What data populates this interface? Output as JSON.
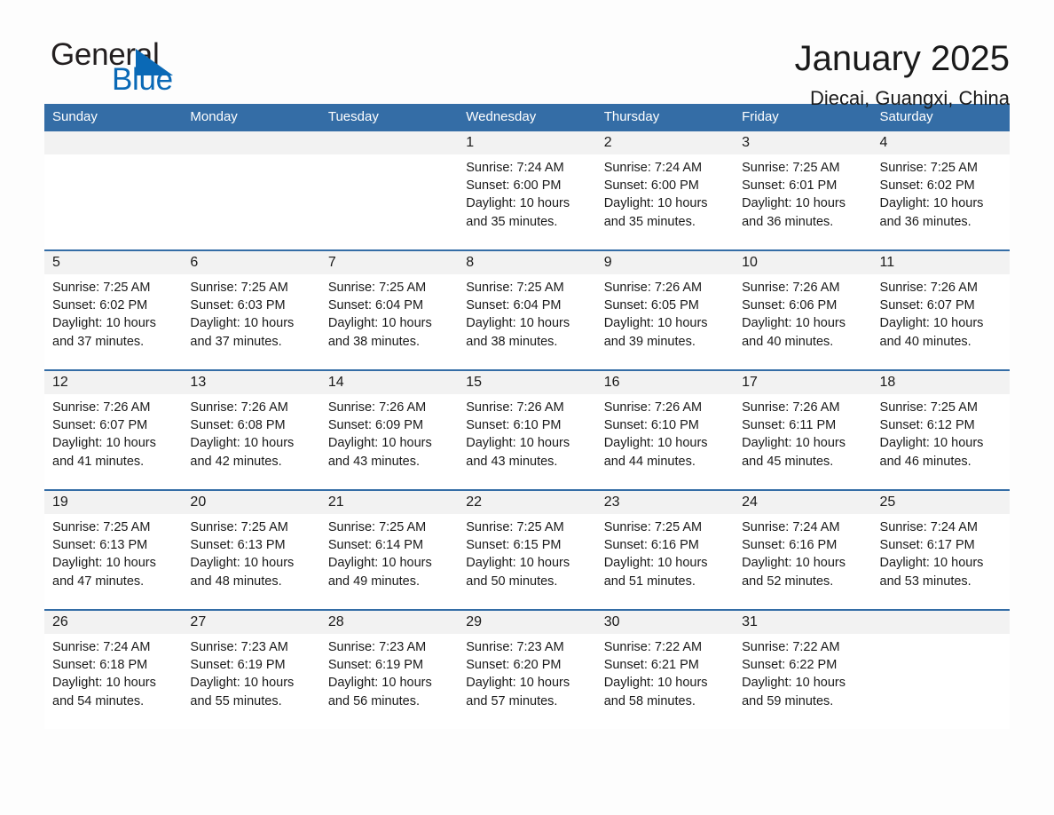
{
  "brand": {
    "name_part1": "General",
    "name_part2": "Blue",
    "triangle_color": "#0a69b6",
    "text_color": "#231f20"
  },
  "header": {
    "title": "January 2025",
    "subtitle": "Diecai, Guangxi, China"
  },
  "theme": {
    "header_blue": "#346DA6",
    "day_band_gray": "#f2f2f2",
    "page_background": "#fdfdfd",
    "text": "#1a1a1a"
  },
  "weekdays": [
    "Sunday",
    "Monday",
    "Tuesday",
    "Wednesday",
    "Thursday",
    "Friday",
    "Saturday"
  ],
  "weeks": [
    [
      {
        "day": "",
        "sunrise": "",
        "sunset": "",
        "daylight1": "",
        "daylight2": "",
        "empty": true
      },
      {
        "day": "",
        "sunrise": "",
        "sunset": "",
        "daylight1": "",
        "daylight2": "",
        "empty": true
      },
      {
        "day": "",
        "sunrise": "",
        "sunset": "",
        "daylight1": "",
        "daylight2": "",
        "empty": true
      },
      {
        "day": "1",
        "sunrise": "Sunrise: 7:24 AM",
        "sunset": "Sunset: 6:00 PM",
        "daylight1": "Daylight: 10 hours",
        "daylight2": "and 35 minutes.",
        "empty": false
      },
      {
        "day": "2",
        "sunrise": "Sunrise: 7:24 AM",
        "sunset": "Sunset: 6:00 PM",
        "daylight1": "Daylight: 10 hours",
        "daylight2": "and 35 minutes.",
        "empty": false
      },
      {
        "day": "3",
        "sunrise": "Sunrise: 7:25 AM",
        "sunset": "Sunset: 6:01 PM",
        "daylight1": "Daylight: 10 hours",
        "daylight2": "and 36 minutes.",
        "empty": false
      },
      {
        "day": "4",
        "sunrise": "Sunrise: 7:25 AM",
        "sunset": "Sunset: 6:02 PM",
        "daylight1": "Daylight: 10 hours",
        "daylight2": "and 36 minutes.",
        "empty": false
      }
    ],
    [
      {
        "day": "5",
        "sunrise": "Sunrise: 7:25 AM",
        "sunset": "Sunset: 6:02 PM",
        "daylight1": "Daylight: 10 hours",
        "daylight2": "and 37 minutes.",
        "empty": false
      },
      {
        "day": "6",
        "sunrise": "Sunrise: 7:25 AM",
        "sunset": "Sunset: 6:03 PM",
        "daylight1": "Daylight: 10 hours",
        "daylight2": "and 37 minutes.",
        "empty": false
      },
      {
        "day": "7",
        "sunrise": "Sunrise: 7:25 AM",
        "sunset": "Sunset: 6:04 PM",
        "daylight1": "Daylight: 10 hours",
        "daylight2": "and 38 minutes.",
        "empty": false
      },
      {
        "day": "8",
        "sunrise": "Sunrise: 7:25 AM",
        "sunset": "Sunset: 6:04 PM",
        "daylight1": "Daylight: 10 hours",
        "daylight2": "and 38 minutes.",
        "empty": false
      },
      {
        "day": "9",
        "sunrise": "Sunrise: 7:26 AM",
        "sunset": "Sunset: 6:05 PM",
        "daylight1": "Daylight: 10 hours",
        "daylight2": "and 39 minutes.",
        "empty": false
      },
      {
        "day": "10",
        "sunrise": "Sunrise: 7:26 AM",
        "sunset": "Sunset: 6:06 PM",
        "daylight1": "Daylight: 10 hours",
        "daylight2": "and 40 minutes.",
        "empty": false
      },
      {
        "day": "11",
        "sunrise": "Sunrise: 7:26 AM",
        "sunset": "Sunset: 6:07 PM",
        "daylight1": "Daylight: 10 hours",
        "daylight2": "and 40 minutes.",
        "empty": false
      }
    ],
    [
      {
        "day": "12",
        "sunrise": "Sunrise: 7:26 AM",
        "sunset": "Sunset: 6:07 PM",
        "daylight1": "Daylight: 10 hours",
        "daylight2": "and 41 minutes.",
        "empty": false
      },
      {
        "day": "13",
        "sunrise": "Sunrise: 7:26 AM",
        "sunset": "Sunset: 6:08 PM",
        "daylight1": "Daylight: 10 hours",
        "daylight2": "and 42 minutes.",
        "empty": false
      },
      {
        "day": "14",
        "sunrise": "Sunrise: 7:26 AM",
        "sunset": "Sunset: 6:09 PM",
        "daylight1": "Daylight: 10 hours",
        "daylight2": "and 43 minutes.",
        "empty": false
      },
      {
        "day": "15",
        "sunrise": "Sunrise: 7:26 AM",
        "sunset": "Sunset: 6:10 PM",
        "daylight1": "Daylight: 10 hours",
        "daylight2": "and 43 minutes.",
        "empty": false
      },
      {
        "day": "16",
        "sunrise": "Sunrise: 7:26 AM",
        "sunset": "Sunset: 6:10 PM",
        "daylight1": "Daylight: 10 hours",
        "daylight2": "and 44 minutes.",
        "empty": false
      },
      {
        "day": "17",
        "sunrise": "Sunrise: 7:26 AM",
        "sunset": "Sunset: 6:11 PM",
        "daylight1": "Daylight: 10 hours",
        "daylight2": "and 45 minutes.",
        "empty": false
      },
      {
        "day": "18",
        "sunrise": "Sunrise: 7:25 AM",
        "sunset": "Sunset: 6:12 PM",
        "daylight1": "Daylight: 10 hours",
        "daylight2": "and 46 minutes.",
        "empty": false
      }
    ],
    [
      {
        "day": "19",
        "sunrise": "Sunrise: 7:25 AM",
        "sunset": "Sunset: 6:13 PM",
        "daylight1": "Daylight: 10 hours",
        "daylight2": "and 47 minutes.",
        "empty": false
      },
      {
        "day": "20",
        "sunrise": "Sunrise: 7:25 AM",
        "sunset": "Sunset: 6:13 PM",
        "daylight1": "Daylight: 10 hours",
        "daylight2": "and 48 minutes.",
        "empty": false
      },
      {
        "day": "21",
        "sunrise": "Sunrise: 7:25 AM",
        "sunset": "Sunset: 6:14 PM",
        "daylight1": "Daylight: 10 hours",
        "daylight2": "and 49 minutes.",
        "empty": false
      },
      {
        "day": "22",
        "sunrise": "Sunrise: 7:25 AM",
        "sunset": "Sunset: 6:15 PM",
        "daylight1": "Daylight: 10 hours",
        "daylight2": "and 50 minutes.",
        "empty": false
      },
      {
        "day": "23",
        "sunrise": "Sunrise: 7:25 AM",
        "sunset": "Sunset: 6:16 PM",
        "daylight1": "Daylight: 10 hours",
        "daylight2": "and 51 minutes.",
        "empty": false
      },
      {
        "day": "24",
        "sunrise": "Sunrise: 7:24 AM",
        "sunset": "Sunset: 6:16 PM",
        "daylight1": "Daylight: 10 hours",
        "daylight2": "and 52 minutes.",
        "empty": false
      },
      {
        "day": "25",
        "sunrise": "Sunrise: 7:24 AM",
        "sunset": "Sunset: 6:17 PM",
        "daylight1": "Daylight: 10 hours",
        "daylight2": "and 53 minutes.",
        "empty": false
      }
    ],
    [
      {
        "day": "26",
        "sunrise": "Sunrise: 7:24 AM",
        "sunset": "Sunset: 6:18 PM",
        "daylight1": "Daylight: 10 hours",
        "daylight2": "and 54 minutes.",
        "empty": false
      },
      {
        "day": "27",
        "sunrise": "Sunrise: 7:23 AM",
        "sunset": "Sunset: 6:19 PM",
        "daylight1": "Daylight: 10 hours",
        "daylight2": "and 55 minutes.",
        "empty": false
      },
      {
        "day": "28",
        "sunrise": "Sunrise: 7:23 AM",
        "sunset": "Sunset: 6:19 PM",
        "daylight1": "Daylight: 10 hours",
        "daylight2": "and 56 minutes.",
        "empty": false
      },
      {
        "day": "29",
        "sunrise": "Sunrise: 7:23 AM",
        "sunset": "Sunset: 6:20 PM",
        "daylight1": "Daylight: 10 hours",
        "daylight2": "and 57 minutes.",
        "empty": false
      },
      {
        "day": "30",
        "sunrise": "Sunrise: 7:22 AM",
        "sunset": "Sunset: 6:21 PM",
        "daylight1": "Daylight: 10 hours",
        "daylight2": "and 58 minutes.",
        "empty": false
      },
      {
        "day": "31",
        "sunrise": "Sunrise: 7:22 AM",
        "sunset": "Sunset: 6:22 PM",
        "daylight1": "Daylight: 10 hours",
        "daylight2": "and 59 minutes.",
        "empty": false
      },
      {
        "day": "",
        "sunrise": "",
        "sunset": "",
        "daylight1": "",
        "daylight2": "",
        "empty": true
      }
    ]
  ]
}
